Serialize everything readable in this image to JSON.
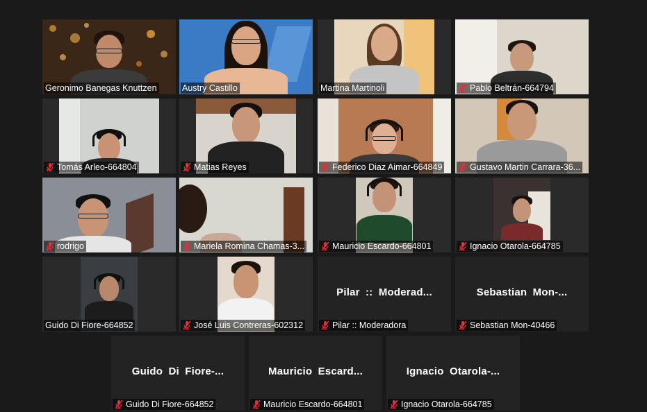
{
  "colors": {
    "background": "#1a1a1a",
    "tile": "#232323",
    "active_border": "#c8e25a",
    "mute_icon": "#e0303a",
    "name_text": "#ffffff"
  },
  "icons": {
    "muted": "microphone-muted-icon"
  },
  "participants": [
    {
      "name": "Geronimo Banegas Knuttzen",
      "muted": false,
      "video": true,
      "active": false
    },
    {
      "name": "Austry Castillo",
      "muted": false,
      "video": true,
      "active": true
    },
    {
      "name": "Martina Martinoli",
      "muted": false,
      "video": true,
      "active": false
    },
    {
      "name": "Pablo Beltrán-664794",
      "muted": true,
      "video": true,
      "active": false
    },
    {
      "name": "Tomás Arleo-664804",
      "muted": true,
      "video": true,
      "active": false
    },
    {
      "name": "Matias Reyes",
      "muted": true,
      "video": true,
      "active": false
    },
    {
      "name": "Federico Diaz Aimar-664849",
      "muted": true,
      "video": true,
      "active": false
    },
    {
      "name": "Gustavo Martin Carrara-36...",
      "muted": true,
      "video": true,
      "active": false
    },
    {
      "name": "rodrigo",
      "muted": true,
      "video": true,
      "active": false
    },
    {
      "name": "Mariela Romina Chamas-3...",
      "muted": true,
      "video": true,
      "active": false
    },
    {
      "name": "Mauricio Escardo-664801",
      "muted": true,
      "video": true,
      "active": false
    },
    {
      "name": "Ignacio Otarola-664785",
      "muted": true,
      "video": true,
      "active": false
    },
    {
      "name": "Guido Di Fiore-664852",
      "muted": false,
      "video": true,
      "active": false
    },
    {
      "name": "José Luis Contreras-602312",
      "muted": true,
      "video": true,
      "active": false
    },
    {
      "name": "Pilar :: Moderadora",
      "muted": true,
      "video": false,
      "display_name": "Pilar  ::  Moderad...",
      "active": false
    },
    {
      "name": "Sebastian Mon-40466",
      "muted": true,
      "video": false,
      "display_name": "Sebastian  Mon-...",
      "active": false
    },
    {
      "name": "Guido Di Fiore-664852",
      "muted": true,
      "video": false,
      "display_name": "Guido  Di  Fiore-...",
      "active": false
    },
    {
      "name": "Mauricio Escardo-664801",
      "muted": true,
      "video": false,
      "display_name": "Mauricio  Escard...",
      "active": false
    },
    {
      "name": "Ignacio Otarola-664785",
      "muted": true,
      "video": false,
      "display_name": "Ignacio  Otarola-...",
      "active": false
    }
  ]
}
